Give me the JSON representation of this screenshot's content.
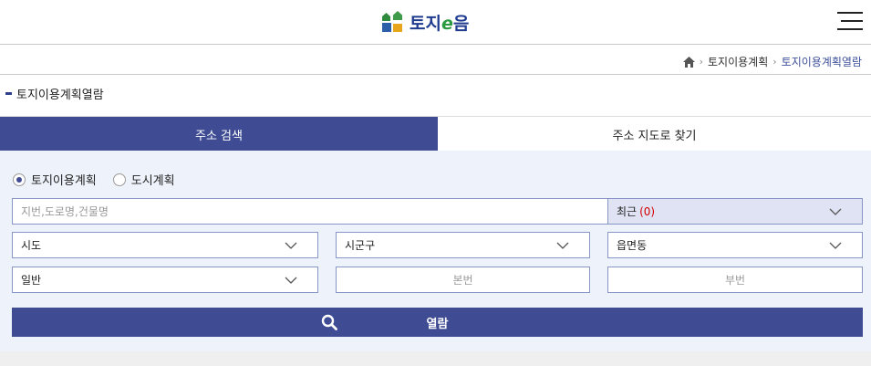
{
  "header": {
    "logo_text": "토지",
    "logo_e": "e",
    "logo_tail": "음",
    "menu_icon": "hamburger-icon"
  },
  "breadcrumb": {
    "home_icon": "home-icon",
    "items": [
      "토지이용계획",
      "토지이용계획열람"
    ]
  },
  "page_title": "토지이용계획열람",
  "tabs": [
    {
      "label": "주소 검색",
      "active": true
    },
    {
      "label": "주소 지도로 찾기",
      "active": false
    }
  ],
  "radios": [
    {
      "label": "토지이용계획",
      "checked": true
    },
    {
      "label": "도시계획",
      "checked": false
    }
  ],
  "search": {
    "placeholder": "지번,도로명,건물명",
    "recent_label": "최근",
    "recent_count": "(0)"
  },
  "selects": {
    "sido": "시도",
    "sigungu": "시군구",
    "eupmyeondong": "읍면동",
    "type": "일반"
  },
  "inputs": {
    "bonbeon": "본번",
    "bubeon": "부번"
  },
  "submit_label": "열람",
  "colors": {
    "primary": "#3f4c94",
    "panel_bg": "#eef3fb",
    "accent_red": "#d40000"
  }
}
